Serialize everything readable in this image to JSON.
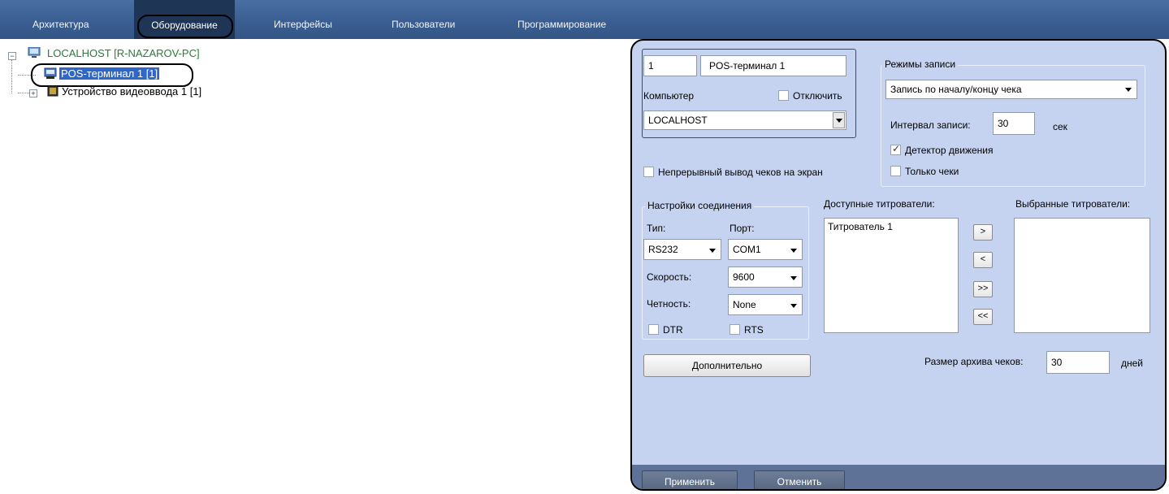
{
  "tabs": [
    {
      "label": "Архитектура",
      "active": false
    },
    {
      "label": "Оборудование",
      "active": true
    },
    {
      "label": "Интерфейсы",
      "active": false
    },
    {
      "label": "Пользователи",
      "active": false
    },
    {
      "label": "Программирование",
      "active": false
    }
  ],
  "tree": {
    "root": {
      "label": "LOCALHOST [R-NAZAROV-PC]",
      "icon": "computer-icon",
      "expander": "−"
    },
    "children": [
      {
        "label": "POS-терминал 1 [1]",
        "icon": "pos-terminal-icon",
        "selected": true
      },
      {
        "label": "Устройство видеоввода 1 [1]",
        "icon": "video-capture-icon",
        "expander": "+"
      }
    ]
  },
  "panel": {
    "id_value": "1",
    "name_value": "POS-терминал 1",
    "computer_label": "Компьютер",
    "disable_label": "Отключить",
    "disable_checked": false,
    "computer_value": "LOCALHOST",
    "recording": {
      "group_title": "Режимы записи",
      "mode_value": "Запись по началу/концу чека",
      "interval_label": "Интервал записи:",
      "interval_value": "30",
      "interval_unit": "сек",
      "motion_label": "Детектор движения",
      "motion_checked": true,
      "receipts_only_label": "Только чеки",
      "receipts_only_checked": false
    },
    "continuous_label": "Непрерывный вывод чеков на экран",
    "continuous_checked": false,
    "connection": {
      "group_title": "Настройки соединения",
      "type_label": "Тип:",
      "type_value": "RS232",
      "port_label": "Порт:",
      "port_value": "COM1",
      "speed_label": "Скорость:",
      "speed_value": "9600",
      "parity_label": "Четность:",
      "parity_value": "None",
      "dtr_label": "DTR",
      "dtr_checked": false,
      "rts_label": "RTS",
      "rts_checked": false
    },
    "available_label": "Доступные титрователи:",
    "available_items": [
      "Титрователь 1"
    ],
    "selected_label": "Выбранные титрователи:",
    "selected_items": [],
    "move_buttons": [
      ">",
      "<",
      ">>",
      "<<"
    ],
    "advanced_button": "Дополнительно",
    "archive_label": "Размер архива чеков:",
    "archive_value": "30",
    "archive_unit": "дней",
    "apply_button": "Применить",
    "cancel_button": "Отменить"
  }
}
